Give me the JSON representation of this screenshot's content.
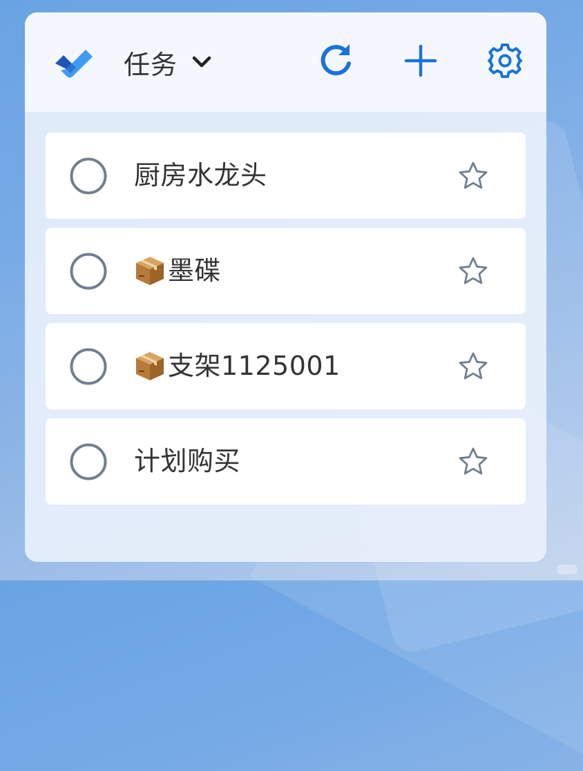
{
  "header": {
    "list_title": "任务"
  },
  "tasks": [
    {
      "icon": "",
      "title": "厨房水龙头"
    },
    {
      "icon": "package-icon",
      "title": "墨碟"
    },
    {
      "icon": "package-icon",
      "title": "支架1125001"
    },
    {
      "icon": "",
      "title": "计划购买"
    }
  ],
  "colors": {
    "accent": "#1a73d9",
    "logo_dark": "#1e56b8",
    "logo_light": "#3f9cf0",
    "check_circle": "#6f7f8e",
    "star_outline": "#6f7f8e",
    "widget_bg": "#e8f0fb",
    "header_bg": "#f4f8fe"
  }
}
